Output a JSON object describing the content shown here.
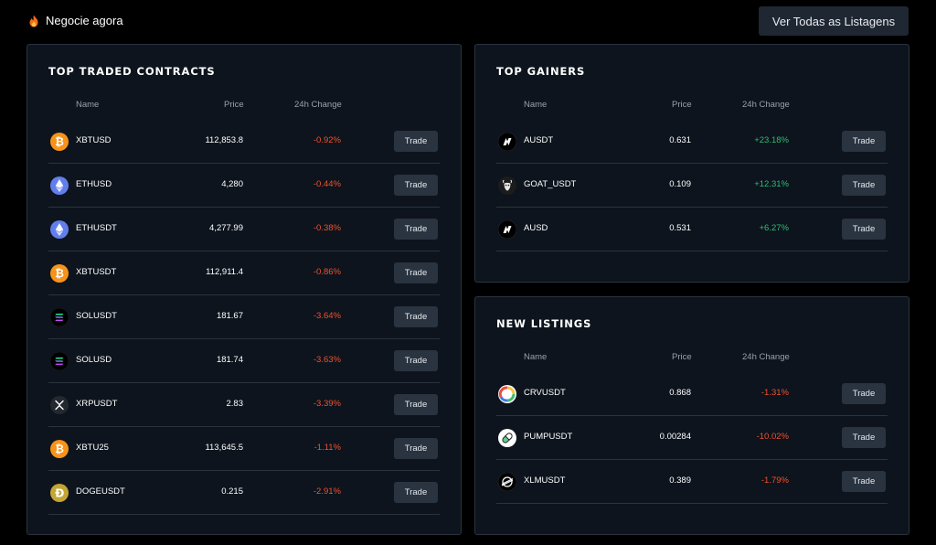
{
  "header": {
    "title": "Negocie agora",
    "view_all_label": "Ver Todas as Listagens"
  },
  "columns": {
    "name": "Name",
    "price": "Price",
    "change": "24h Change"
  },
  "trade_label": "Trade",
  "colors": {
    "negative": "#f0512f",
    "positive": "#2fbd72",
    "card_bg": "#0d141d",
    "button_bg": "#2a3340"
  },
  "top_traded": {
    "title": "TOP TRADED CONTRACTS",
    "rows": [
      {
        "symbol": "XBTUSD",
        "price": "112,853.8",
        "change": "-0.92%",
        "icon": "bitcoin-icon"
      },
      {
        "symbol": "ETHUSD",
        "price": "4,280",
        "change": "-0.44%",
        "icon": "ethereum-icon"
      },
      {
        "symbol": "ETHUSDT",
        "price": "4,277.99",
        "change": "-0.38%",
        "icon": "ethereum-icon"
      },
      {
        "symbol": "XBTUSDT",
        "price": "112,911.4",
        "change": "-0.86%",
        "icon": "bitcoin-icon"
      },
      {
        "symbol": "SOLUSDT",
        "price": "181.67",
        "change": "-3.64%",
        "icon": "solana-icon"
      },
      {
        "symbol": "SOLUSD",
        "price": "181.74",
        "change": "-3.63%",
        "icon": "solana-icon"
      },
      {
        "symbol": "XRPUSDT",
        "price": "2.83",
        "change": "-3.39%",
        "icon": "xrp-icon"
      },
      {
        "symbol": "XBTU25",
        "price": "113,645.5",
        "change": "-1.11%",
        "icon": "bitcoin-icon"
      },
      {
        "symbol": "DOGEUSDT",
        "price": "0.215",
        "change": "-2.91%",
        "icon": "dogecoin-icon"
      }
    ]
  },
  "top_gainers": {
    "title": "TOP GAINERS",
    "rows": [
      {
        "symbol": "AUSDT",
        "price": "0.631",
        "change": "+23.18%",
        "icon": "a-token-icon"
      },
      {
        "symbol": "GOAT_USDT",
        "price": "0.109",
        "change": "+12.31%",
        "icon": "goat-icon"
      },
      {
        "symbol": "AUSD",
        "price": "0.531",
        "change": "+6.27%",
        "icon": "a-token-icon"
      }
    ]
  },
  "new_listings": {
    "title": "NEW LISTINGS",
    "rows": [
      {
        "symbol": "CRVUSDT",
        "price": "0.868",
        "change": "-1.31%",
        "icon": "curve-icon"
      },
      {
        "symbol": "PUMPUSDT",
        "price": "0.00284",
        "change": "-10.02%",
        "icon": "pill-icon"
      },
      {
        "symbol": "XLMUSDT",
        "price": "0.389",
        "change": "-1.79%",
        "icon": "stellar-icon"
      }
    ]
  }
}
